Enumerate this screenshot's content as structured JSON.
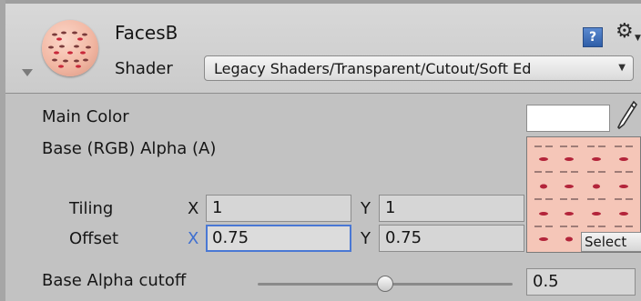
{
  "material": {
    "name": "FacesB",
    "shader_label": "Shader",
    "shader_value": "Legacy Shaders/Transparent/Cutout/Soft Ed"
  },
  "properties": {
    "main_color_label": "Main Color",
    "main_color_value": "#ffffff",
    "base_label": "Base (RGB) Alpha (A)",
    "tiling_label": "Tiling",
    "offset_label": "Offset",
    "x_axis": "X",
    "y_axis": "Y",
    "tiling_x": "1",
    "tiling_y": "1",
    "offset_x": "0.75",
    "offset_y": "0.75",
    "select_label": "Select",
    "alpha_cutoff_label": "Base Alpha cutoff",
    "alpha_cutoff_value": "0.5",
    "alpha_cutoff_fraction": 0.5
  },
  "icons": {
    "help": "help-book-icon",
    "settings": "gear-icon",
    "picker": "eyedropper-icon",
    "fold": "foldout-arrow-icon"
  }
}
